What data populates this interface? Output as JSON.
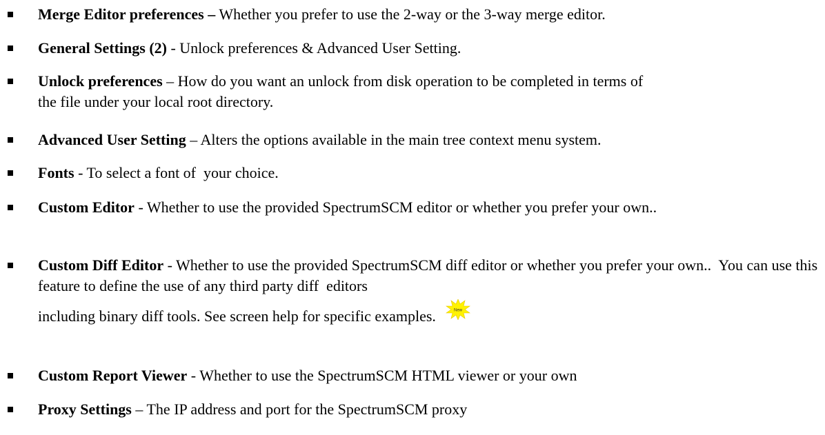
{
  "items": [
    {
      "term": "Merge Editor preferences –",
      "separator": " ",
      "description": "Whether you prefer to use the 2-way or the 3-way merge editor."
    },
    {
      "term": "General Settings (2)",
      "separator": " - ",
      "description": "Unlock preferences & Advanced User Setting."
    },
    {
      "term": "Unlock preferences",
      "separator": " – ",
      "description": "How do you want an unlock from disk operation to be completed in terms of the file under your local root directory."
    },
    {
      "term": "Advanced User Setting",
      "separator": " – ",
      "description": "Alters the options available in the main tree context menu system."
    },
    {
      "term": "Fonts",
      "separator": " - ",
      "description": "To select a font of  your choice."
    },
    {
      "term": "Custom Editor",
      "separator": " - ",
      "description": "Whether to use the provided SpectrumSCM editor or whether you prefer your own.."
    },
    {
      "term": "Custom Diff Editor",
      "separator": " - ",
      "description": "Whether to use the provided SpectrumSCM diff editor or whether you prefer your own..  You can use this feature to define the use of any third party diff  editors",
      "description_2": "including binary diff tools. See screen help for specific examples.",
      "badge_label": "New",
      "badge_color": "#FFF200"
    },
    {
      "term": "Custom Report Viewer",
      "separator": " - ",
      "description": "Whether to use the SpectrumSCM HTML viewer or your own"
    },
    {
      "term": "Proxy Settings",
      "separator": " – ",
      "description": "The IP address and port for the SpectrumSCM proxy"
    }
  ]
}
